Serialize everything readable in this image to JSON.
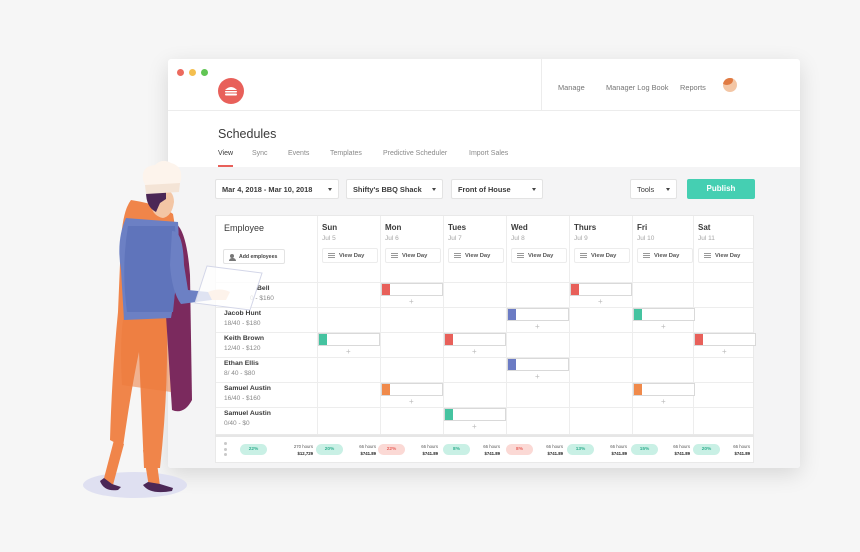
{
  "window": {
    "traffic_lights": [
      "#ec6a5e",
      "#f4bf4f",
      "#61c554"
    ]
  },
  "logo": {
    "icon": "burger-icon",
    "color": "#e8605a"
  },
  "topnav": {
    "items": [
      {
        "label": "Manage"
      },
      {
        "label": "Manager Log Book"
      },
      {
        "label": "Reports"
      }
    ],
    "avatar": "user-avatar"
  },
  "page": {
    "title": "Schedules",
    "tabs": [
      {
        "label": "View",
        "active": true
      },
      {
        "label": "Sync",
        "active": false
      },
      {
        "label": "Events",
        "active": false
      },
      {
        "label": "Templates",
        "active": false
      },
      {
        "label": "Predictive Scheduler",
        "active": false
      },
      {
        "label": "Import Sales",
        "active": false
      }
    ]
  },
  "toolbar": {
    "date_range": "Mar 4, 2018 - Mar 10, 2018",
    "location": "Shifty's BBQ Shack",
    "department": "Front of House",
    "tools": "Tools",
    "publish": "Publish"
  },
  "schedule": {
    "employee_header": "Employee",
    "add_employees": "Add employees",
    "view_day_label": "View Day",
    "days": [
      {
        "name": "Sun",
        "date": "Jul 5"
      },
      {
        "name": "Mon",
        "date": "Jul 6"
      },
      {
        "name": "Tues",
        "date": "Jul 7"
      },
      {
        "name": "Wed",
        "date": "Jul 8"
      },
      {
        "name": "Thurs",
        "date": "Jul 9"
      },
      {
        "name": "Fri",
        "date": "Jul 10"
      },
      {
        "name": "Sat",
        "date": "Jul 11"
      }
    ],
    "employees": [
      {
        "name": "Bell",
        "hours": "0 - $160",
        "shifts": [
          {
            "day": 1,
            "color": "#e8605a"
          },
          {
            "day": 4,
            "color": "#e8605a"
          }
        ]
      },
      {
        "name": "Jacob Hunt",
        "hours": "18/40 - $180",
        "shifts": [
          {
            "day": 3,
            "color": "#6b7bc4"
          },
          {
            "day": 5,
            "color": "#45c3a0"
          }
        ]
      },
      {
        "name": "Keith Brown",
        "hours": "12/40 - $120",
        "shifts": [
          {
            "day": 0,
            "color": "#45c3a0"
          },
          {
            "day": 2,
            "color": "#e8605a"
          },
          {
            "day": 6,
            "color": "#e8605a"
          }
        ]
      },
      {
        "name": "Ethan Ellis",
        "hours": "8/ 40 - $80",
        "shifts": [
          {
            "day": 3,
            "color": "#6b7bc4"
          }
        ]
      },
      {
        "name": "Samuel Austin",
        "hours": "16/40 - $160",
        "shifts": [
          {
            "day": 1,
            "color": "#f08a4b"
          },
          {
            "day": 5,
            "color": "#f08a4b"
          }
        ]
      },
      {
        "name": "Samuel Austin",
        "hours": "0/40 - $0",
        "shifts": [
          {
            "day": 2,
            "color": "#45c3a0"
          }
        ]
      }
    ]
  },
  "footer": {
    "stats": [
      {
        "pct": "22%",
        "hours": "270 hours",
        "cost": "$12,729",
        "tone": "teal"
      },
      {
        "pct": "20%",
        "hours": "66 hours",
        "cost": "$741.89",
        "tone": "teal"
      },
      {
        "pct": "22%",
        "hours": "66 hours",
        "cost": "$741.89",
        "tone": "red"
      },
      {
        "pct": "8%",
        "hours": "66 hours",
        "cost": "$741.89",
        "tone": "teal"
      },
      {
        "pct": "8%",
        "hours": "66 hours",
        "cost": "$741.89",
        "tone": "red"
      },
      {
        "pct": "13%",
        "hours": "66 hours",
        "cost": "$741.89",
        "tone": "teal"
      },
      {
        "pct": "15%",
        "hours": "66 hours",
        "cost": "$741.89",
        "tone": "teal"
      },
      {
        "pct": "20%",
        "hours": "66 hours",
        "cost": "$741.89",
        "tone": "teal"
      }
    ]
  },
  "illustration": {
    "subject": "chef-with-tablet",
    "apron_color": "#7b2a5e",
    "pants_color": "#f0854a",
    "shirt_color": "#6c80c4"
  }
}
